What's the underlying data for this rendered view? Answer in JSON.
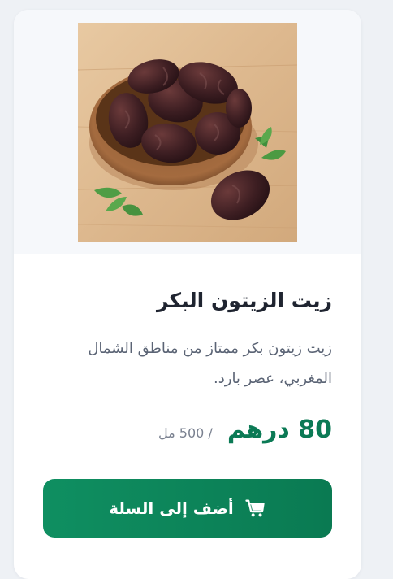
{
  "product": {
    "title": "زيت الزيتون البكر",
    "description": "زيت زيتون بكر ممتاز من مناطق الشمال المغربي، عصر بارد.",
    "price": "80 درهم",
    "unit": "/ 500 مل",
    "image_alt": "dates-in-wooden-bowl"
  },
  "actions": {
    "add_to_cart_label": "أضف إلى السلة",
    "cart_icon": "cart-icon"
  },
  "colors": {
    "accent": "#0b7a55",
    "button_start": "#0f8f61",
    "button_end": "#0a7a52",
    "title": "#1f2430",
    "muted": "#5b6475"
  }
}
